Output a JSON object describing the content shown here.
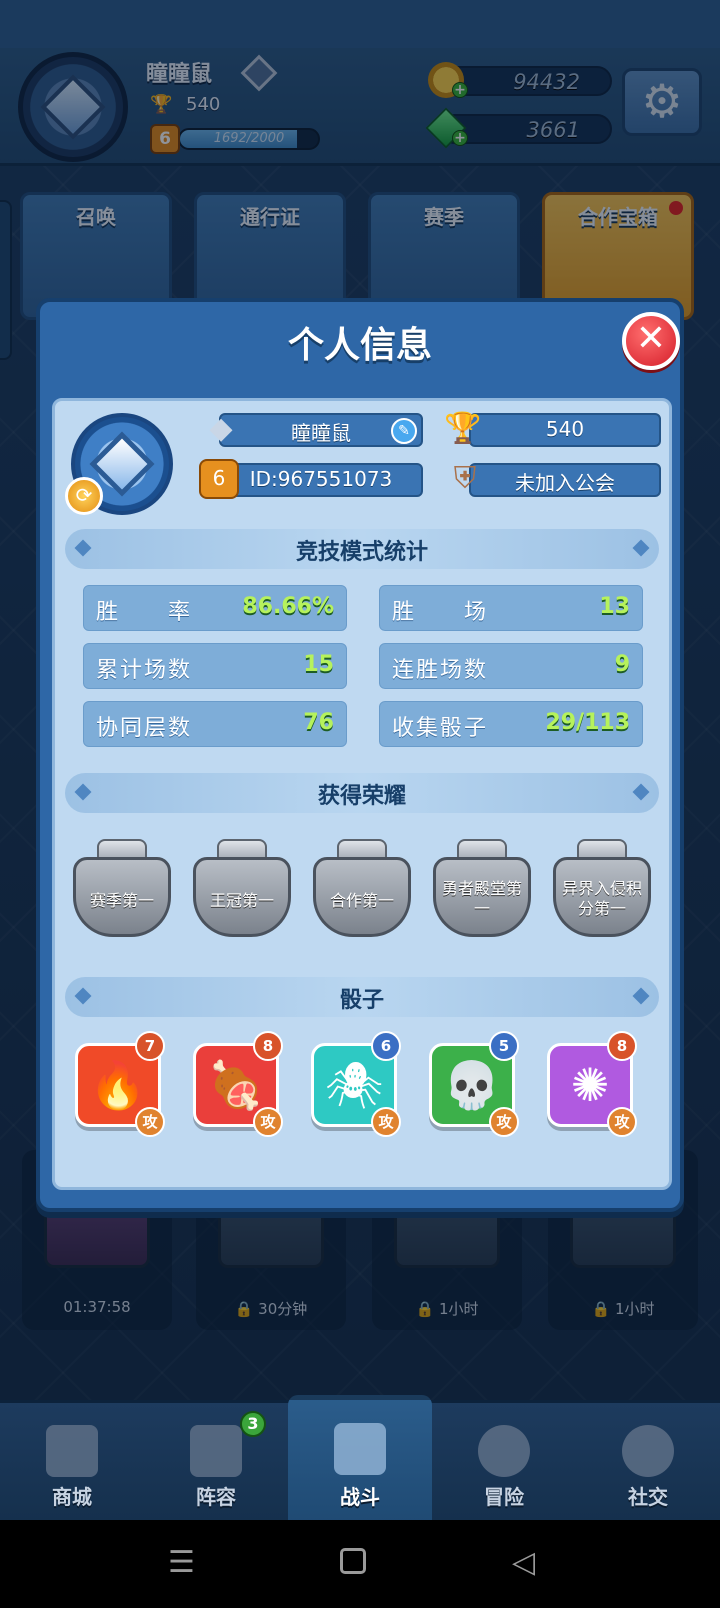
{
  "header": {
    "player_name": "瞳瞳鼠",
    "trophies": "540",
    "level": "6",
    "xp_text": "1692/2000",
    "xp_progress": 0.846,
    "gold": "94432",
    "gems": "3661"
  },
  "features": [
    {
      "label": "召唤"
    },
    {
      "label": "通行证"
    },
    {
      "label": "赛季"
    },
    {
      "label": "合作宝箱"
    }
  ],
  "chests": [
    {
      "label": "01:37:58"
    },
    {
      "label": "30分钟"
    },
    {
      "label": "1小时"
    },
    {
      "label": "1小时"
    }
  ],
  "nav": {
    "items": [
      {
        "label": "商城"
      },
      {
        "label": "阵容"
      },
      {
        "label": "战斗"
      },
      {
        "label": "冒险"
      },
      {
        "label": "社交"
      }
    ],
    "lineup_badge": "3"
  },
  "dialog": {
    "title": "个人信息",
    "profile": {
      "name": "瞳瞳鼠",
      "trophies": "540",
      "level": "6",
      "id": "ID:967551073",
      "guild": "未加入公会"
    },
    "stats_title": "竞技模式统计",
    "stats": [
      {
        "label": "胜　　率",
        "value": "86.66%"
      },
      {
        "label": "胜　　场",
        "value": "13"
      },
      {
        "label": "累计场数",
        "value": "15"
      },
      {
        "label": "连胜场数",
        "value": "9"
      },
      {
        "label": "协同层数",
        "value": "76"
      },
      {
        "label": "收集骰子",
        "value": "29/113"
      }
    ],
    "honors_title": "获得荣耀",
    "honors": [
      {
        "label": "赛季第一"
      },
      {
        "label": "王冠第一"
      },
      {
        "label": "合作第一"
      },
      {
        "label": "勇者殿堂第一"
      },
      {
        "label": "异界入侵积分第一"
      }
    ],
    "dice_title": "骰子",
    "dice": [
      {
        "icon": "fire-icon",
        "level": "7",
        "tag": "攻",
        "color": "#f04a28"
      },
      {
        "icon": "meat-icon",
        "level": "8",
        "tag": "攻",
        "color": "#ea3f3b"
      },
      {
        "icon": "spider-icon",
        "level": "6",
        "tag": "攻",
        "color": "#2ec9c3"
      },
      {
        "icon": "skull-icon",
        "level": "5",
        "tag": "攻",
        "color": "#3cb04a"
      },
      {
        "icon": "virus-icon",
        "level": "8",
        "tag": "攻",
        "color": "#b05ae0"
      }
    ]
  }
}
